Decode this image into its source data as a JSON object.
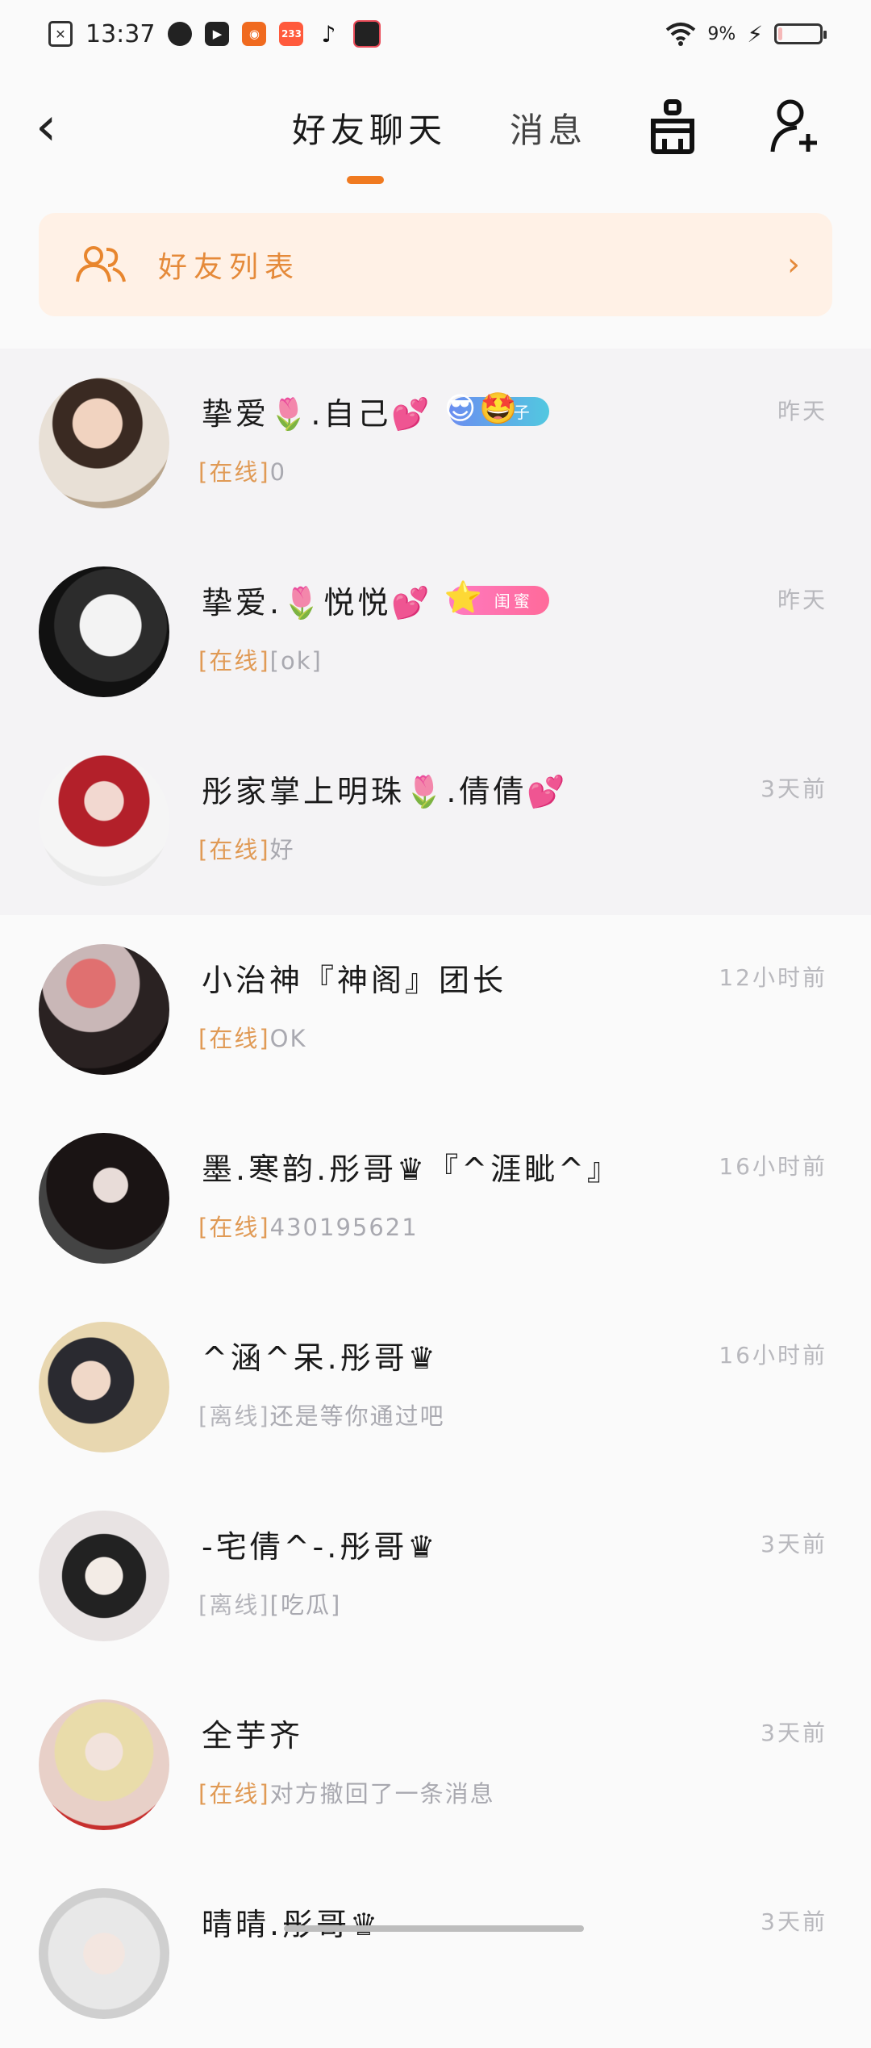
{
  "status_bar": {
    "time": "13:37",
    "battery_percent": "9%",
    "battery_level": 0.09,
    "app_icons": [
      "close-notification-icon",
      "leaf-app-icon",
      "video-play-icon",
      "orange-app-icon",
      "233-app-icon",
      "tiktok-icon",
      "video-record-icon"
    ],
    "app_233_label": "233"
  },
  "header": {
    "tab_friends": "好友聊天",
    "tab_messages": "消息",
    "accent_color": "#f07a20"
  },
  "friend_list_banner": {
    "label": "好友列表"
  },
  "chats": [
    {
      "name": "挚爱🌷.自己💕",
      "badge": "搭子",
      "badge_emoji": "😎🤩",
      "status": "[在线]",
      "message": "0",
      "time": "昨天",
      "online": true,
      "pinned": true
    },
    {
      "name": "挚爱.🌷悦悦💕",
      "badge": "闺蜜",
      "badge_emoji": "⭐",
      "status": "[在线]",
      "message": "[ok]",
      "time": "昨天",
      "online": true,
      "pinned": true
    },
    {
      "name": "彤家掌上明珠🌷.倩倩💕",
      "status": "[在线]",
      "message": "好",
      "time": "3天前",
      "online": true,
      "pinned": true
    },
    {
      "name": "小治神『神阁』团长",
      "status": "[在线]",
      "message": "OK",
      "time": "12小时前",
      "online": true,
      "pinned": false
    },
    {
      "name": "墨.寒韵.彤哥♛『^涯眦^』",
      "status": "[在线]",
      "message": "430195621",
      "time": "16小时前",
      "online": true,
      "pinned": false
    },
    {
      "name": "^涵^呆.彤哥♛",
      "status": "[离线]",
      "message": "还是等你通过吧",
      "time": "16小时前",
      "online": false,
      "pinned": false
    },
    {
      "name": "-宅倩^-.彤哥♛",
      "status": "[离线]",
      "message": "[吃瓜]",
      "time": "3天前",
      "online": false,
      "pinned": false
    },
    {
      "name": "全芋齐",
      "status": "[在线]",
      "message": "对方撤回了一条消息",
      "time": "3天前",
      "online": true,
      "pinned": false
    },
    {
      "name": "晴晴.彤哥♛",
      "status": "",
      "message": "",
      "time": "3天前",
      "online": true,
      "pinned": false
    }
  ]
}
